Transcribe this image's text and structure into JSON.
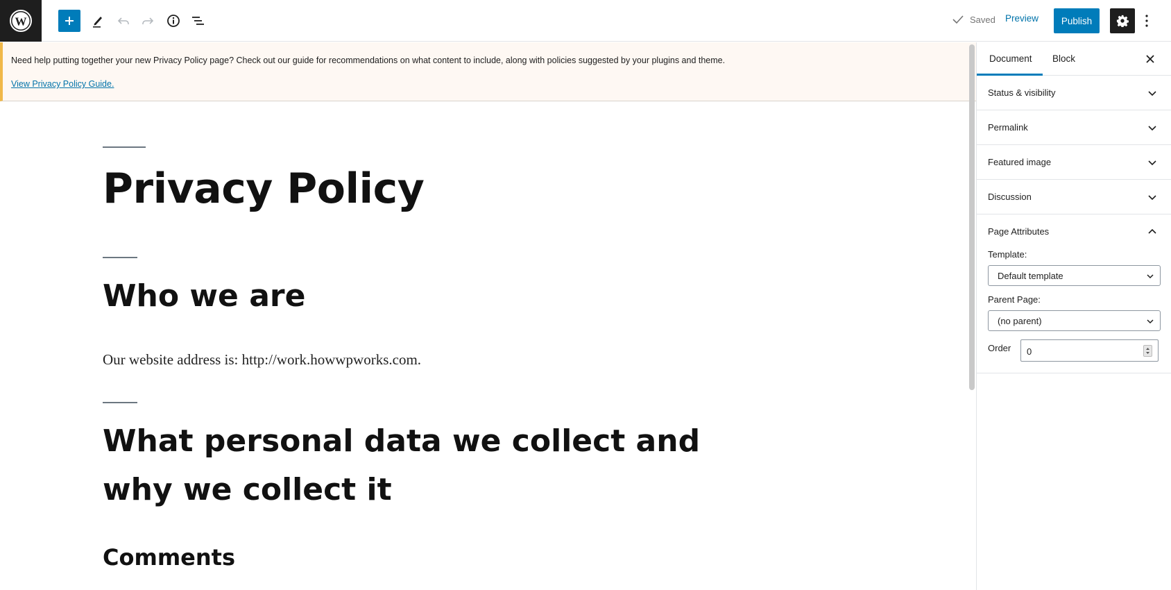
{
  "toolbar": {
    "saved_label": "Saved",
    "preview_label": "Preview",
    "publish_label": "Publish",
    "icons": [
      "wordpress-logo",
      "plus-icon",
      "pencil-icon",
      "undo-icon",
      "redo-icon",
      "info-icon",
      "list-view-icon",
      "check-icon",
      "gear-icon",
      "more-vertical-icon"
    ]
  },
  "notice": {
    "text": "Need help putting together your new Privacy Policy page? Check out our guide for recommendations on what content to include, along with policies suggested by your plugins and theme.",
    "link": "View Privacy Policy Guide."
  },
  "content": {
    "title": "Privacy Policy",
    "h2_who": "Who we are",
    "para_who": "Our website address is: http://work.howwpworks.com.",
    "h2_data_line1": "What personal data we collect and",
    "h2_data_line2": "why we collect it",
    "h3_comments": "Comments"
  },
  "sidebar": {
    "tabs": [
      {
        "label": "Document",
        "active": true
      },
      {
        "label": "Block",
        "active": false
      }
    ],
    "panels": [
      {
        "label": "Status & visibility",
        "expanded": false
      },
      {
        "label": "Permalink",
        "expanded": false
      },
      {
        "label": "Featured image",
        "expanded": false
      },
      {
        "label": "Discussion",
        "expanded": false
      }
    ],
    "page_attributes": {
      "label": "Page Attributes",
      "expanded": true,
      "template_label": "Template:",
      "template_value": "Default template",
      "parent_label": "Parent Page:",
      "parent_value": "(no parent)",
      "order_label": "Order",
      "order_value": "0"
    }
  },
  "colors": {
    "accent": "#007cba",
    "link": "#0073aa",
    "notice_bg": "#fef8f3",
    "notice_border": "#f0b849",
    "dark": "#1e1e1e"
  }
}
